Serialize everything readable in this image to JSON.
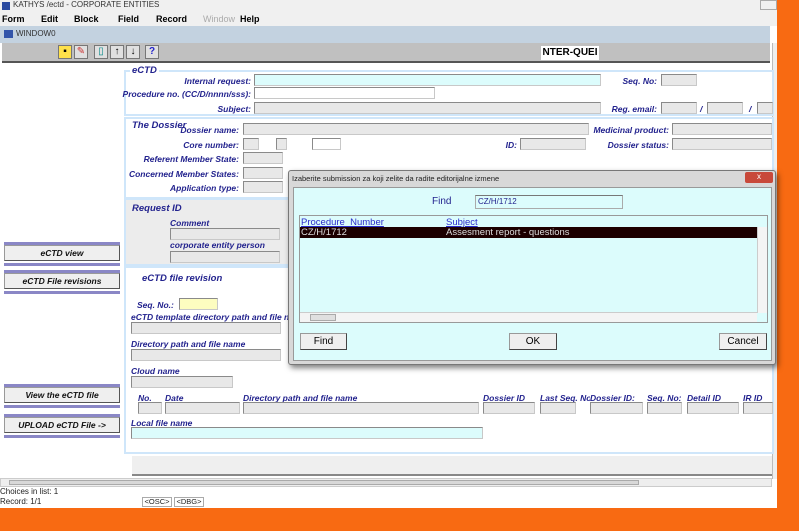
{
  "app": {
    "title": "KATHYS /ectd - CORPORATE ENTITIES",
    "window_title": "WINDOW0",
    "mode": "NTER-QUEI"
  },
  "menu": [
    "Form",
    "Edit",
    "Block",
    "Field",
    "Record",
    "Window",
    "Help"
  ],
  "toolbar": {
    "icons": [
      "save-icon",
      "clear-icon",
      "exit-icon",
      "up-arrow-icon",
      "down-arrow-icon",
      "help-icon"
    ],
    "up": "↑",
    "down": "↓",
    "help": "?"
  },
  "left_buttons": {
    "ectd_view": "eCTD view",
    "file_revisions": "eCTD File revisions",
    "view_file": "View the eCTD file",
    "upload": "UPLOAD eCTD File ->"
  },
  "ectd": {
    "legend": "eCTD",
    "internal_request": "Internal request:",
    "procedure_no": "Procedure no. (CC/D/nnnn/sss):",
    "subject": "Subject:",
    "seq_no": "Seq. No:",
    "reg_email": "Reg. email:",
    "slash": "/"
  },
  "dossier": {
    "legend": "The Dossier",
    "dossier_name": "Dossier name:",
    "core_number": "Core number:",
    "referent": "Referent Member State:",
    "concerned": "Concerned Member States:",
    "application_type": "Application type:",
    "id": "ID:",
    "medicinal_product": "Medicinal product:",
    "dossier_status": "Dossier status:"
  },
  "request": {
    "legend": "Request ID",
    "comment": "Comment",
    "person": "corporate entity person"
  },
  "revision": {
    "legend": "eCTD file revision",
    "seq_no": "Seq. No.:",
    "template_path": "eCTD template directory path and file name",
    "dir_path": "Directory path and file name",
    "cloud_name": "Cloud name",
    "local_file": "Local file name",
    "columns": [
      "No.",
      "Date",
      "Directory path and file name",
      "Dossier ID",
      "Last Seq. No",
      "Dossier ID:",
      "Seq. No:",
      "Detail ID",
      "IR ID"
    ]
  },
  "status": {
    "choices": "Choices in list: 1",
    "record": "Record: 1/1",
    "osc": "<OSC>",
    "dbg": "<DBG>"
  },
  "dialog": {
    "title": "Izaberite submission za koji zelite da radite editorijalne izmene",
    "find_label": "Find",
    "find_value": "CZ/H/1712",
    "columns": [
      "Procedure_Number",
      "Subject"
    ],
    "rows": [
      [
        "CZ/H/1712",
        "Assesment report - questions"
      ]
    ],
    "find_button": "Find",
    "ok_button": "OK",
    "cancel_button": "Cancel",
    "close": "x"
  }
}
